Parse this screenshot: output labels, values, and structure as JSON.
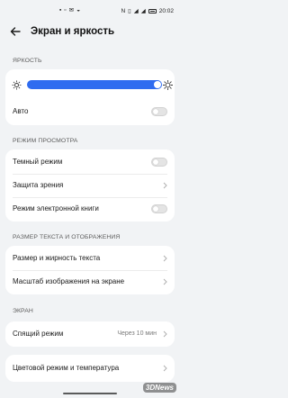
{
  "status_bar": {
    "center_icons": [
      "notification-icon",
      "image-icon",
      "message-icon",
      "wifi-icon"
    ],
    "nfc_label": "N",
    "time": "20:02"
  },
  "header": {
    "title": "Экран и яркость"
  },
  "brightness": {
    "section_label": "ЯРКОСТЬ",
    "level_percent": 100,
    "auto_label": "Авто",
    "auto_on": false
  },
  "view_mode": {
    "section_label": "РЕЖИМ ПРОСМОТРА",
    "dark_mode_label": "Темный режим",
    "dark_mode_on": false,
    "eye_comfort_label": "Защита зрения",
    "ebook_label": "Режим электронной книги",
    "ebook_on": false
  },
  "text_display": {
    "section_label": "РАЗМЕР ТЕКСТА И ОТОБРАЖЕНИЯ",
    "font_size_label": "Размер и жирность текста",
    "scale_label": "Масштаб изображения на экране"
  },
  "screen": {
    "section_label": "ЭКРАН",
    "sleep_label": "Спящий режим",
    "sleep_value": "Через 10 мин",
    "color_label": "Цветовой режим и температура"
  },
  "watermark": "3DNews",
  "colors": {
    "accent": "#2f6cf0",
    "background": "#f1f3f5",
    "card": "#ffffff"
  }
}
